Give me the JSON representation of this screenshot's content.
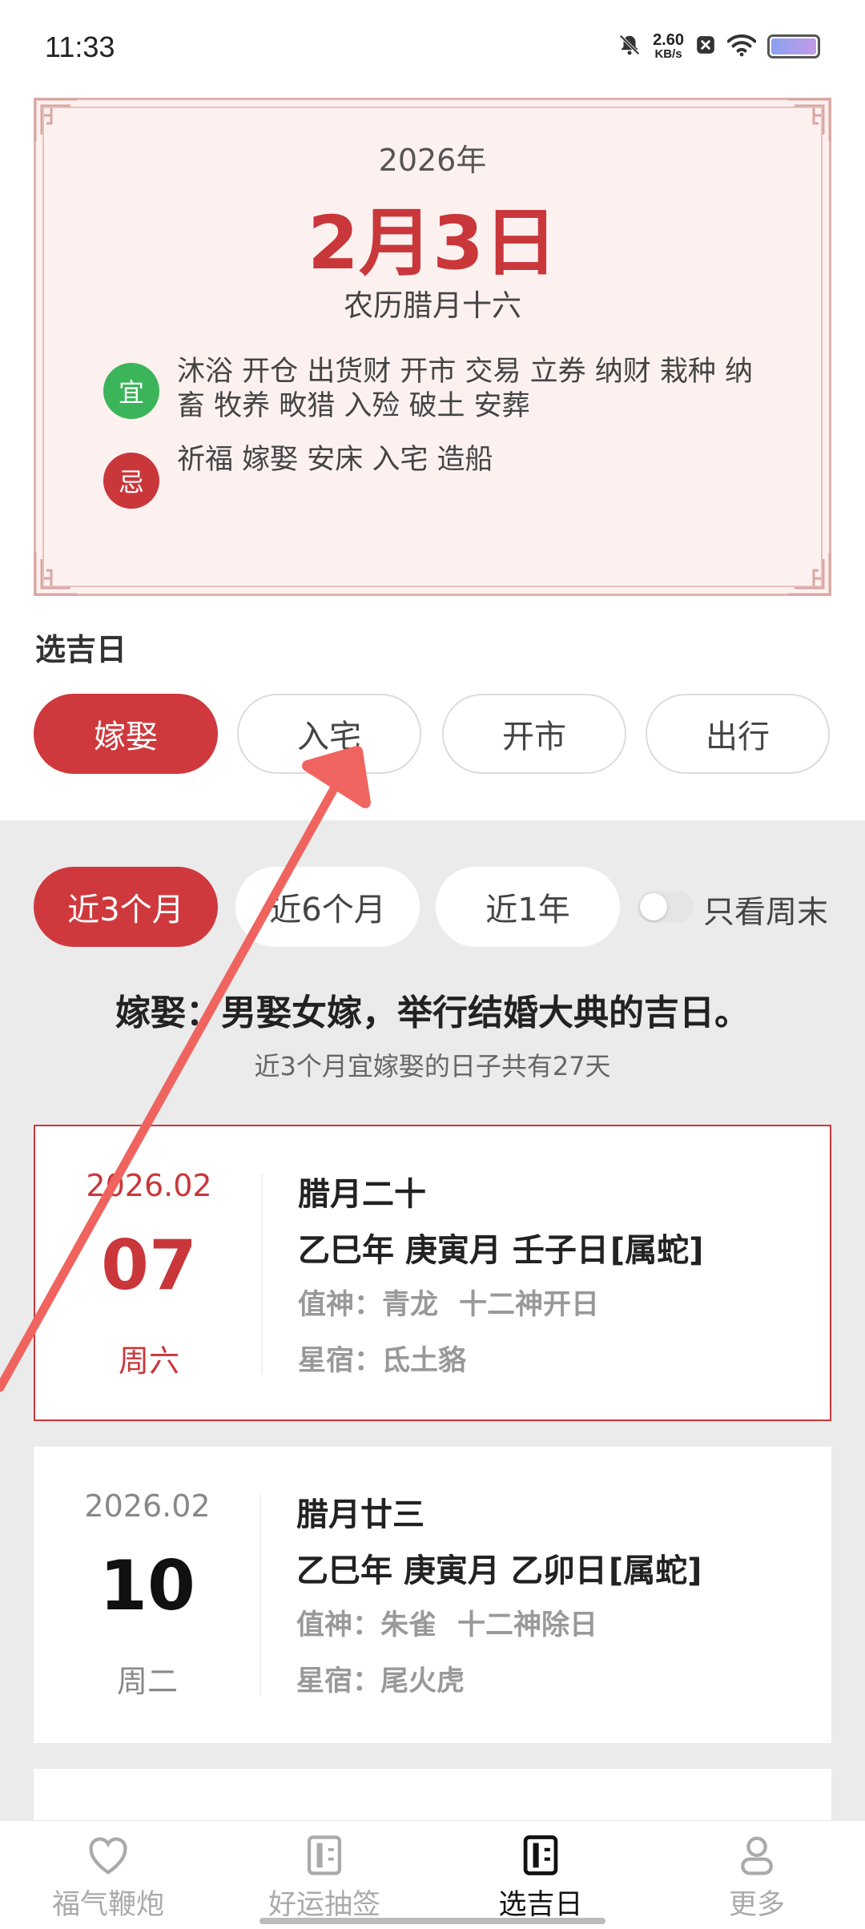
{
  "status_bar": {
    "time": "11:33",
    "speed_value": "2.60",
    "speed_unit": "KB/s",
    "icons": [
      "mute-bell-icon",
      "notification-x-icon",
      "wifi-icon",
      "battery-icon"
    ]
  },
  "almanac": {
    "year": "2026年",
    "date": "2月3日",
    "lunar": "农历腊月十六",
    "yi_label": "宜",
    "yi_text": "沐浴 开仓 出货财 开市 交易 立券 纳财 栽种 纳畜 牧养 畋猎 入殓 破土 安葬",
    "ji_label": "忌",
    "ji_text": "祈福 嫁娶 安床 入宅 造船"
  },
  "select_day": {
    "title": "选吉日",
    "categories": [
      "嫁娶",
      "入宅",
      "开市",
      "出行"
    ],
    "active_category": "嫁娶"
  },
  "ranges": {
    "items": [
      "近3个月",
      "近6个月",
      "近1年"
    ],
    "active": "近3个月",
    "weekend_toggle_label": "只看周末",
    "weekend_toggle_on": false
  },
  "summary": {
    "description": "嫁娶：男娶女嫁，举行结婚大典的吉日。",
    "count_text": "近3个月宜嫁娶的日子共有27天"
  },
  "days": [
    {
      "year_month": "2026.02",
      "day": "07",
      "weekday": "周六",
      "lunar": "腊月二十",
      "ganzhi": "乙巳年 庚寅月 壬子日",
      "zodiac": "[属蛇]",
      "god": "值神：青龙",
      "twelve_god": "十二神开日",
      "star": "星宿：氐土貉",
      "selected": true
    },
    {
      "year_month": "2026.02",
      "day": "10",
      "weekday": "周二",
      "lunar": "腊月廿三",
      "ganzhi": "乙巳年 庚寅月 乙卯日",
      "zodiac": "[属蛇]",
      "god": "值神：朱雀",
      "twelve_god": "十二神除日",
      "star": "星宿：尾火虎",
      "selected": false
    }
  ],
  "tabbar": {
    "tabs": [
      {
        "label": "福气鞭炮",
        "icon": "heart-icon"
      },
      {
        "label": "好运抽签",
        "icon": "lottery-icon"
      },
      {
        "label": "选吉日",
        "icon": "calendar-book-icon"
      },
      {
        "label": "更多",
        "icon": "person-icon"
      }
    ],
    "active": "选吉日"
  },
  "colors": {
    "accent": "#cf393d",
    "yi_green": "#3cb55a",
    "card_bg": "#fdf1f0",
    "annotation_arrow": "#f0645f"
  }
}
